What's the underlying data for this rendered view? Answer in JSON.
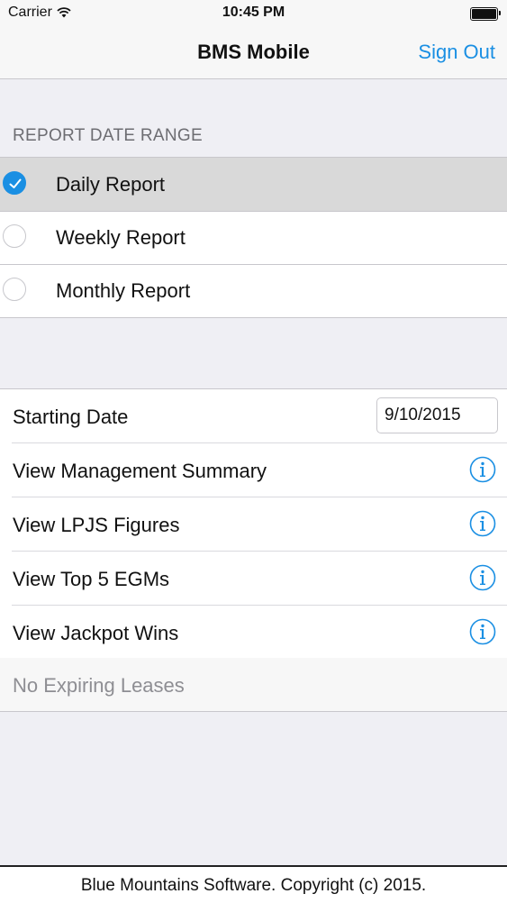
{
  "status_bar": {
    "carrier": "Carrier",
    "time": "10:45 PM"
  },
  "nav": {
    "title": "BMS Mobile",
    "sign_out": "Sign Out"
  },
  "report_range": {
    "header": "REPORT DATE RANGE",
    "options": [
      {
        "label": "Daily Report",
        "selected": true
      },
      {
        "label": "Weekly Report",
        "selected": false
      },
      {
        "label": "Monthly Report",
        "selected": false
      }
    ]
  },
  "actions": {
    "starting_date_label": "Starting Date",
    "starting_date_value": "9/10/2015",
    "items": [
      {
        "label": "View Management Summary",
        "icon": "info-icon"
      },
      {
        "label": "View LPJS Figures",
        "icon": "info-icon"
      },
      {
        "label": "View Top 5 EGMs",
        "icon": "info-icon"
      },
      {
        "label": "View Jackpot Wins",
        "icon": "info-icon"
      }
    ],
    "expiring_leases": "No Expiring Leases"
  },
  "footer": {
    "copyright": "Blue Mountains Software. Copyright (c) 2015."
  },
  "colors": {
    "accent": "#1a8fe3",
    "background": "#efeff4"
  }
}
